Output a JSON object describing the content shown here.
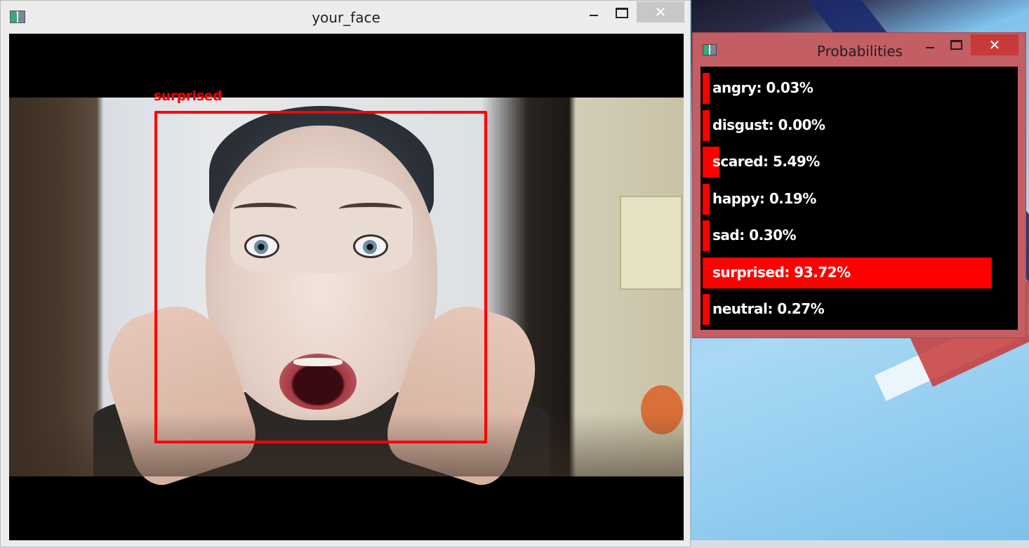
{
  "main_window": {
    "title": "your_face",
    "close_glyph": "✕"
  },
  "detection": {
    "label": "surprised",
    "box_color": "#ff0000"
  },
  "probabilities_window": {
    "title": "Probabilities",
    "close_glyph": "✕",
    "bar_color": "#ff0000",
    "rows": [
      {
        "label": "angry: 0.03%",
        "value": 0.03
      },
      {
        "label": "disgust: 0.00%",
        "value": 0.0
      },
      {
        "label": "scared: 5.49%",
        "value": 5.49
      },
      {
        "label": "happy: 0.19%",
        "value": 0.19
      },
      {
        "label": "sad: 0.30%",
        "value": 0.3
      },
      {
        "label": "surprised: 93.72%",
        "value": 93.72
      },
      {
        "label": "neutral: 0.27%",
        "value": 0.27
      }
    ]
  },
  "icons": [
    "app-window-icon",
    "minimize-icon",
    "maximize-icon",
    "close-icon"
  ]
}
